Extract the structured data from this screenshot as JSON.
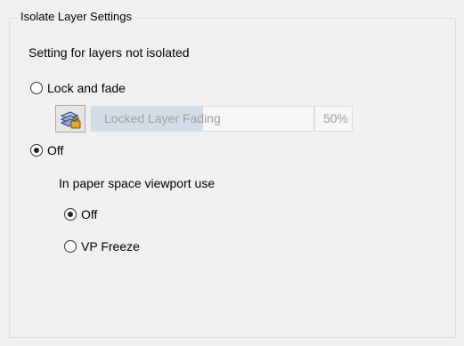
{
  "group": {
    "title": "Isolate Layer Settings",
    "subtitle": "Setting for layers not isolated"
  },
  "options": {
    "lock_and_fade": {
      "label": "Lock and fade",
      "selected": false
    },
    "off": {
      "label": "Off",
      "selected": true
    }
  },
  "fading": {
    "label": "Locked Layer Fading",
    "value_percent": 50,
    "value_text": "50%",
    "icon": "locked-layer-icon"
  },
  "paper_space": {
    "label": "In paper space viewport use",
    "options": [
      {
        "label": "Off",
        "selected": true
      },
      {
        "label": "VP Freeze",
        "selected": false
      }
    ]
  },
  "colors": {
    "background": "#f0f0f0",
    "slider_fill": "#d3dde8",
    "disabled_text": "#a0a0a0"
  }
}
